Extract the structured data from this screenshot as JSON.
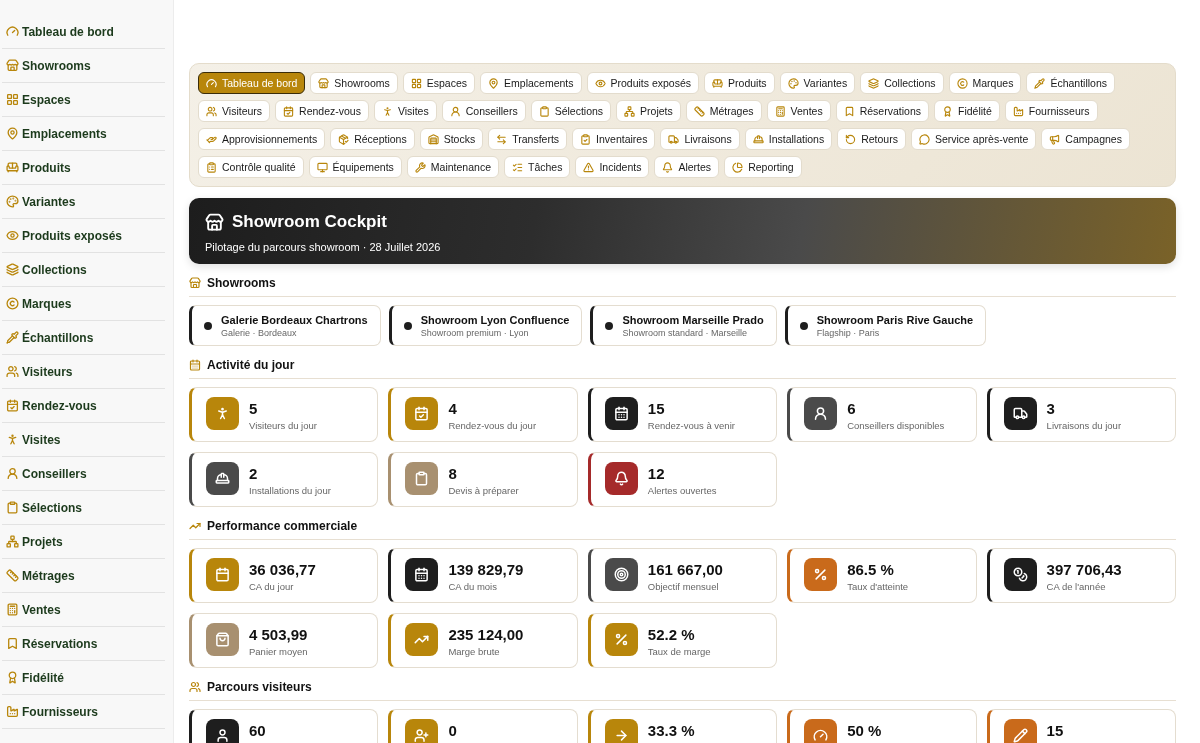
{
  "sidebar": {
    "items": [
      {
        "label": "Tableau de bord"
      },
      {
        "label": "Showrooms"
      },
      {
        "label": "Espaces"
      },
      {
        "label": "Emplacements"
      },
      {
        "label": "Produits"
      },
      {
        "label": "Variantes"
      },
      {
        "label": "Produits exposés"
      },
      {
        "label": "Collections"
      },
      {
        "label": "Marques"
      },
      {
        "label": "Échantillons"
      },
      {
        "label": "Visiteurs"
      },
      {
        "label": "Rendez-vous"
      },
      {
        "label": "Visites"
      },
      {
        "label": "Conseillers"
      },
      {
        "label": "Sélections"
      },
      {
        "label": "Projets"
      },
      {
        "label": "Métrages"
      },
      {
        "label": "Ventes"
      },
      {
        "label": "Réservations"
      },
      {
        "label": "Fidélité"
      },
      {
        "label": "Fournisseurs"
      }
    ]
  },
  "nav": {
    "tabs": [
      {
        "label": "Tableau de bord",
        "selected": true
      },
      {
        "label": "Showrooms",
        "selected": false
      },
      {
        "label": "Espaces",
        "selected": false
      },
      {
        "label": "Emplacements",
        "selected": false
      },
      {
        "label": "Produits exposés",
        "selected": false
      },
      {
        "label": "Produits",
        "selected": false
      },
      {
        "label": "Variantes",
        "selected": false
      },
      {
        "label": "Collections",
        "selected": false
      },
      {
        "label": "Marques",
        "selected": false
      },
      {
        "label": "Échantillons",
        "selected": false
      },
      {
        "label": "Visiteurs",
        "selected": false
      },
      {
        "label": "Rendez-vous",
        "selected": false
      },
      {
        "label": "Visites",
        "selected": false
      },
      {
        "label": "Conseillers",
        "selected": false
      },
      {
        "label": "Sélections",
        "selected": false
      },
      {
        "label": "Projets",
        "selected": false
      },
      {
        "label": "Métrages",
        "selected": false
      },
      {
        "label": "Ventes",
        "selected": false
      },
      {
        "label": "Réservations",
        "selected": false
      },
      {
        "label": "Fidélité",
        "selected": false
      },
      {
        "label": "Fournisseurs",
        "selected": false
      },
      {
        "label": "Approvisionnements",
        "selected": false
      },
      {
        "label": "Réceptions",
        "selected": false
      },
      {
        "label": "Stocks",
        "selected": false
      },
      {
        "label": "Transferts",
        "selected": false
      },
      {
        "label": "Inventaires",
        "selected": false
      },
      {
        "label": "Livraisons",
        "selected": false
      },
      {
        "label": "Installations",
        "selected": false
      },
      {
        "label": "Retours",
        "selected": false
      },
      {
        "label": "Service après-vente",
        "selected": false
      },
      {
        "label": "Campagnes",
        "selected": false
      },
      {
        "label": "Contrôle qualité",
        "selected": false
      },
      {
        "label": "Équipements",
        "selected": false
      },
      {
        "label": "Maintenance",
        "selected": false
      },
      {
        "label": "Tâches",
        "selected": false
      },
      {
        "label": "Incidents",
        "selected": false
      },
      {
        "label": "Alertes",
        "selected": false
      },
      {
        "label": "Reporting",
        "selected": false
      }
    ]
  },
  "hero": {
    "title": "Showroom Cockpit",
    "subtitle": "Pilotage du parcours showroom · 28 Juillet 2026"
  },
  "sections": [
    {
      "kind": "showrooms",
      "title": "Showrooms",
      "showrooms": [
        {
          "name": "Galerie Bordeaux Chartrons",
          "detail": "Galerie · Bordeaux"
        },
        {
          "name": "Showroom Lyon Confluence",
          "detail": "Showroom premium · Lyon"
        },
        {
          "name": "Showroom Marseille Prado",
          "detail": "Showroom standard · Marseille"
        },
        {
          "name": "Showroom Paris Rive Gauche",
          "detail": "Flagship · Paris"
        }
      ]
    },
    {
      "kind": "metrics",
      "title": "Activité du jour",
      "cards": [
        {
          "value": "5",
          "label": "Visiteurs du jour",
          "color": "#b8860b"
        },
        {
          "value": "4",
          "label": "Rendez-vous du jour",
          "color": "#b8860b"
        },
        {
          "value": "15",
          "label": "Rendez-vous à venir",
          "color": "#1e1e1e"
        },
        {
          "value": "6",
          "label": "Conseillers disponibles",
          "color": "#4a4a4a"
        },
        {
          "value": "3",
          "label": "Livraisons du jour",
          "color": "#1e1e1e"
        },
        {
          "value": "2",
          "label": "Installations du jour",
          "color": "#4a4a4a"
        },
        {
          "value": "8",
          "label": "Devis à préparer",
          "color": "#a89070"
        },
        {
          "value": "12",
          "label": "Alertes ouvertes",
          "color": "#a52a2a"
        }
      ]
    },
    {
      "kind": "metrics",
      "title": "Performance commerciale",
      "cards": [
        {
          "value": "36 036,77",
          "label": "CA du jour",
          "color": "#b8860b"
        },
        {
          "value": "139 829,79",
          "label": "CA du mois",
          "color": "#1e1e1e"
        },
        {
          "value": "161 667,00",
          "label": "Objectif mensuel",
          "color": "#4a4a4a"
        },
        {
          "value": "86.5 %",
          "label": "Taux d'atteinte",
          "color": "#c96a1b"
        },
        {
          "value": "397 706,43",
          "label": "CA de l'année",
          "color": "#1e1e1e"
        },
        {
          "value": "4 503,99",
          "label": "Panier moyen",
          "color": "#a89070"
        },
        {
          "value": "235 124,00",
          "label": "Marge brute",
          "color": "#b8860b"
        },
        {
          "value": "52.2 %",
          "label": "Taux de marge",
          "color": "#b8860b"
        }
      ]
    },
    {
      "kind": "metrics",
      "title": "Parcours visiteurs",
      "cards": [
        {
          "value": "60",
          "color": "#1e1e1e"
        },
        {
          "value": "0",
          "color": "#b8860b"
        },
        {
          "value": "33.3 %",
          "color": "#b8860b"
        },
        {
          "value": "50 %",
          "color": "#c96a1b"
        },
        {
          "value": "15",
          "color": "#c96a1b"
        }
      ]
    }
  ]
}
